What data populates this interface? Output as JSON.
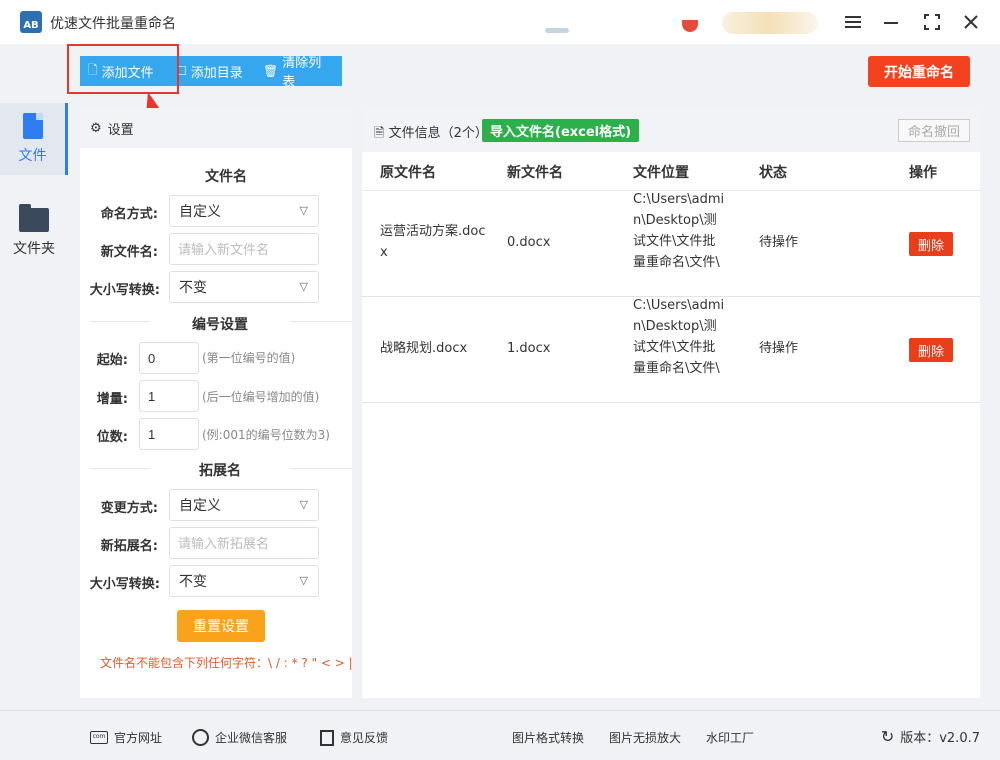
{
  "app": {
    "title": "优速文件批量重命名",
    "logo_text": "AB"
  },
  "window_controls": {
    "menu_icon": "menu-icon",
    "minimize_icon": "minimize-icon",
    "maximize_icon": "maximize-icon",
    "close_icon": "close-icon"
  },
  "toolbar": {
    "add_file": "添加文件",
    "add_dir": "添加目录",
    "clear_list": "清除列表",
    "start_rename": "开始重命名"
  },
  "sidebar": {
    "items": [
      {
        "label": "文件",
        "icon": "file-icon",
        "active": true
      },
      {
        "label": "文件夹",
        "icon": "folder-icon",
        "active": false
      }
    ]
  },
  "settings": {
    "header": "设置",
    "filename_section": "文件名",
    "naming_mode_label": "命名方式:",
    "naming_mode_value": "自定义",
    "new_name_label": "新文件名:",
    "new_name_placeholder": "请输入新文件名",
    "case_label": "大小写转换:",
    "case_value": "不变",
    "numbering_section": "编号设置",
    "start_label": "起始:",
    "start_value": "0",
    "start_hint": "(第一位编号的值)",
    "step_label": "增量:",
    "step_value": "1",
    "step_hint": "(后一位编号增加的值)",
    "digits_label": "位数:",
    "digits_value": "1",
    "digits_hint": "(例:001的编号位数为3)",
    "ext_section": "拓展名",
    "ext_mode_label": "变更方式:",
    "ext_mode_value": "自定义",
    "new_ext_label": "新拓展名:",
    "new_ext_placeholder": "请输入新拓展名",
    "ext_case_label": "大小写转换:",
    "ext_case_value": "不变",
    "reset_button": "重置设置",
    "warning": "文件名不能包含下列任何字符：\\ / : * ? \" < > |"
  },
  "file_panel": {
    "title": "文件信息（2个）",
    "import_button": "导入文件名(excel格式)",
    "undo_button": "命名撤回",
    "columns": [
      "原文件名",
      "新文件名",
      "文件位置",
      "状态",
      "操作"
    ],
    "rows": [
      {
        "original": "运营活动方案.docx",
        "new_name": "0.docx",
        "location": "C:\\Users\\admin\\Desktop\\测试文件\\文件批量重命名\\文件\\",
        "status": "待操作",
        "action": "删除"
      },
      {
        "original": "战略规划.docx",
        "new_name": "1.docx",
        "location": "C:\\Users\\admin\\Desktop\\测试文件\\文件批量重命名\\文件\\",
        "status": "待操作",
        "action": "删除"
      }
    ]
  },
  "footer": {
    "website": "官方网址",
    "wechat": "企业微信客服",
    "feedback": "意见反馈",
    "format_convert": "图片格式转换",
    "lossless_zoom": "图片无损放大",
    "watermark": "水印工厂",
    "version": "版本：v2.0.7"
  },
  "colors": {
    "accent_blue": "#35a7ee",
    "start_red": "#f4421f",
    "import_green": "#2bb04c",
    "reset_orange": "#f9a21b",
    "delete_red": "#ea3e1b"
  }
}
